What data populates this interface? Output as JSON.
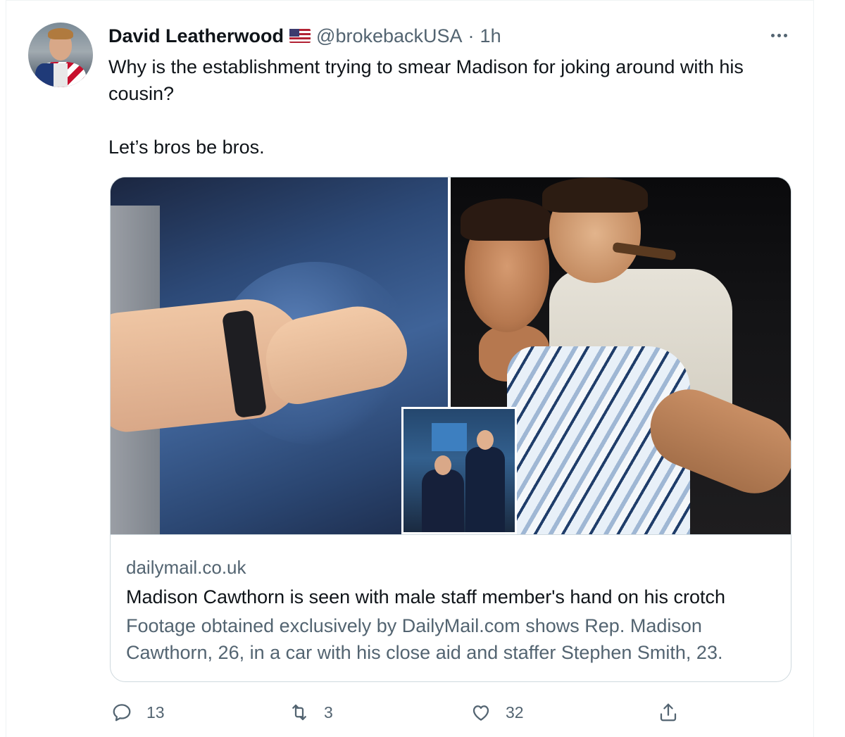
{
  "tweet": {
    "display_name": "David Leatherwood",
    "handle": "@brokebackUSA",
    "separator": "·",
    "time": "1h",
    "text_line1": "Why is the establishment trying to smear Madison for joking around with his cousin?",
    "text_line2": "Let’s bros be bros."
  },
  "icons": {
    "more": "more-options-icon",
    "reply": "reply-icon",
    "retweet": "retweet-icon",
    "like": "like-icon",
    "share": "share-icon",
    "flag": "us-flag-icon"
  },
  "card": {
    "domain": "dailymail.co.uk",
    "title": "Madison Cawthorn is seen with male staff member's hand on his crotch",
    "description": "Footage obtained exclusively by DailyMail.com shows Rep. Madison Cawthorn, 26, in a car with his close aid and staffer Stephen Smith, 23."
  },
  "actions": {
    "replies": "13",
    "retweets": "3",
    "likes": "32"
  },
  "colors": {
    "text_primary": "#0f1419",
    "text_secondary": "#536471",
    "border": "#cfd9de"
  }
}
